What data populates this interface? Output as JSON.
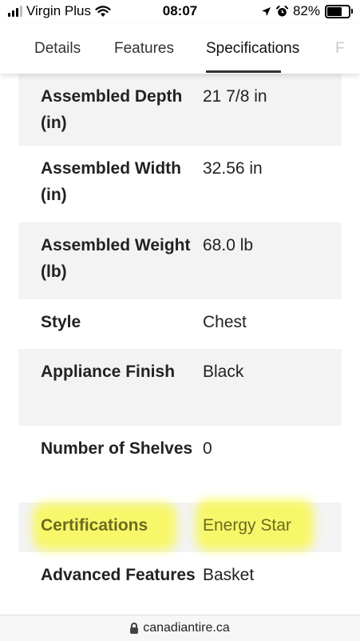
{
  "status_bar": {
    "carrier": "Virgin Plus",
    "time": "08:07",
    "battery_percent": "82%",
    "battery_level": 0.82,
    "icons": [
      "signal-icon",
      "wifi-icon",
      "location-arrow-icon",
      "alarm-icon",
      "battery-icon"
    ]
  },
  "tabs": [
    {
      "label": "Details",
      "active": false
    },
    {
      "label": "Features",
      "active": false
    },
    {
      "label": "Specifications",
      "active": true
    },
    {
      "label": "F",
      "active": false
    }
  ],
  "specs": [
    {
      "label": "Assembled Depth (in)",
      "value": "21 7/8 in"
    },
    {
      "label": "Assembled Width (in)",
      "value": "32.56 in"
    },
    {
      "label": "Assembled Weight (lb)",
      "value": "68.0 lb"
    },
    {
      "label": "Style",
      "value": "Chest"
    },
    {
      "label": "Appliance Finish",
      "value": "Black"
    },
    {
      "label": "Number of Shelves",
      "value": "0"
    },
    {
      "label": "Certifications",
      "value": "Energy Star",
      "highlighted": true
    },
    {
      "label": "Advanced Features",
      "value": "Basket"
    }
  ],
  "url_bar": {
    "domain": "canadiantire.ca"
  },
  "colors": {
    "row_shade": "#f3f3f3",
    "highlight": "#faf83c",
    "highlight_text": "#6b6b1e"
  }
}
